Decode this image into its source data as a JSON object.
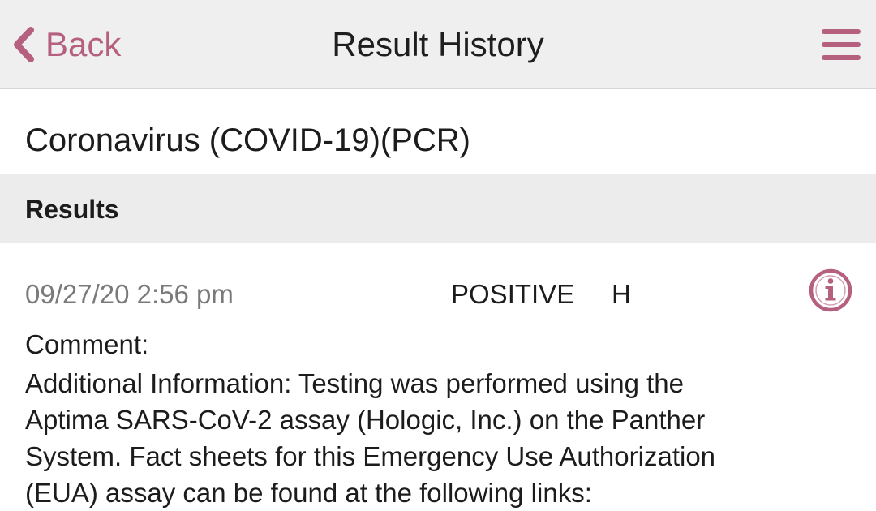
{
  "colors": {
    "accent": "#b5607f",
    "nav_background": "#efefef",
    "section_background": "#ececec",
    "muted_text": "#7a7a7a"
  },
  "navbar": {
    "back_label": "Back",
    "back_icon": "chevron-left-icon",
    "title": "Result History",
    "menu_icon": "hamburger-menu-icon"
  },
  "test": {
    "name": "Coronavirus (COVID-19)(PCR)"
  },
  "section": {
    "label": "Results"
  },
  "result": {
    "datetime": "09/27/20 2:56 pm",
    "value": "POSITIVE",
    "flag": "H",
    "info_icon": "info-icon",
    "comment_label": "Comment:",
    "comment_lines": [
      "Additional Information: Testing was performed using the",
      "Aptima SARS-CoV-2 assay (Hologic, Inc.) on the Panther",
      "System. Fact sheets for this Emergency Use Authorization",
      "(EUA) assay can be found at the following links:"
    ]
  }
}
